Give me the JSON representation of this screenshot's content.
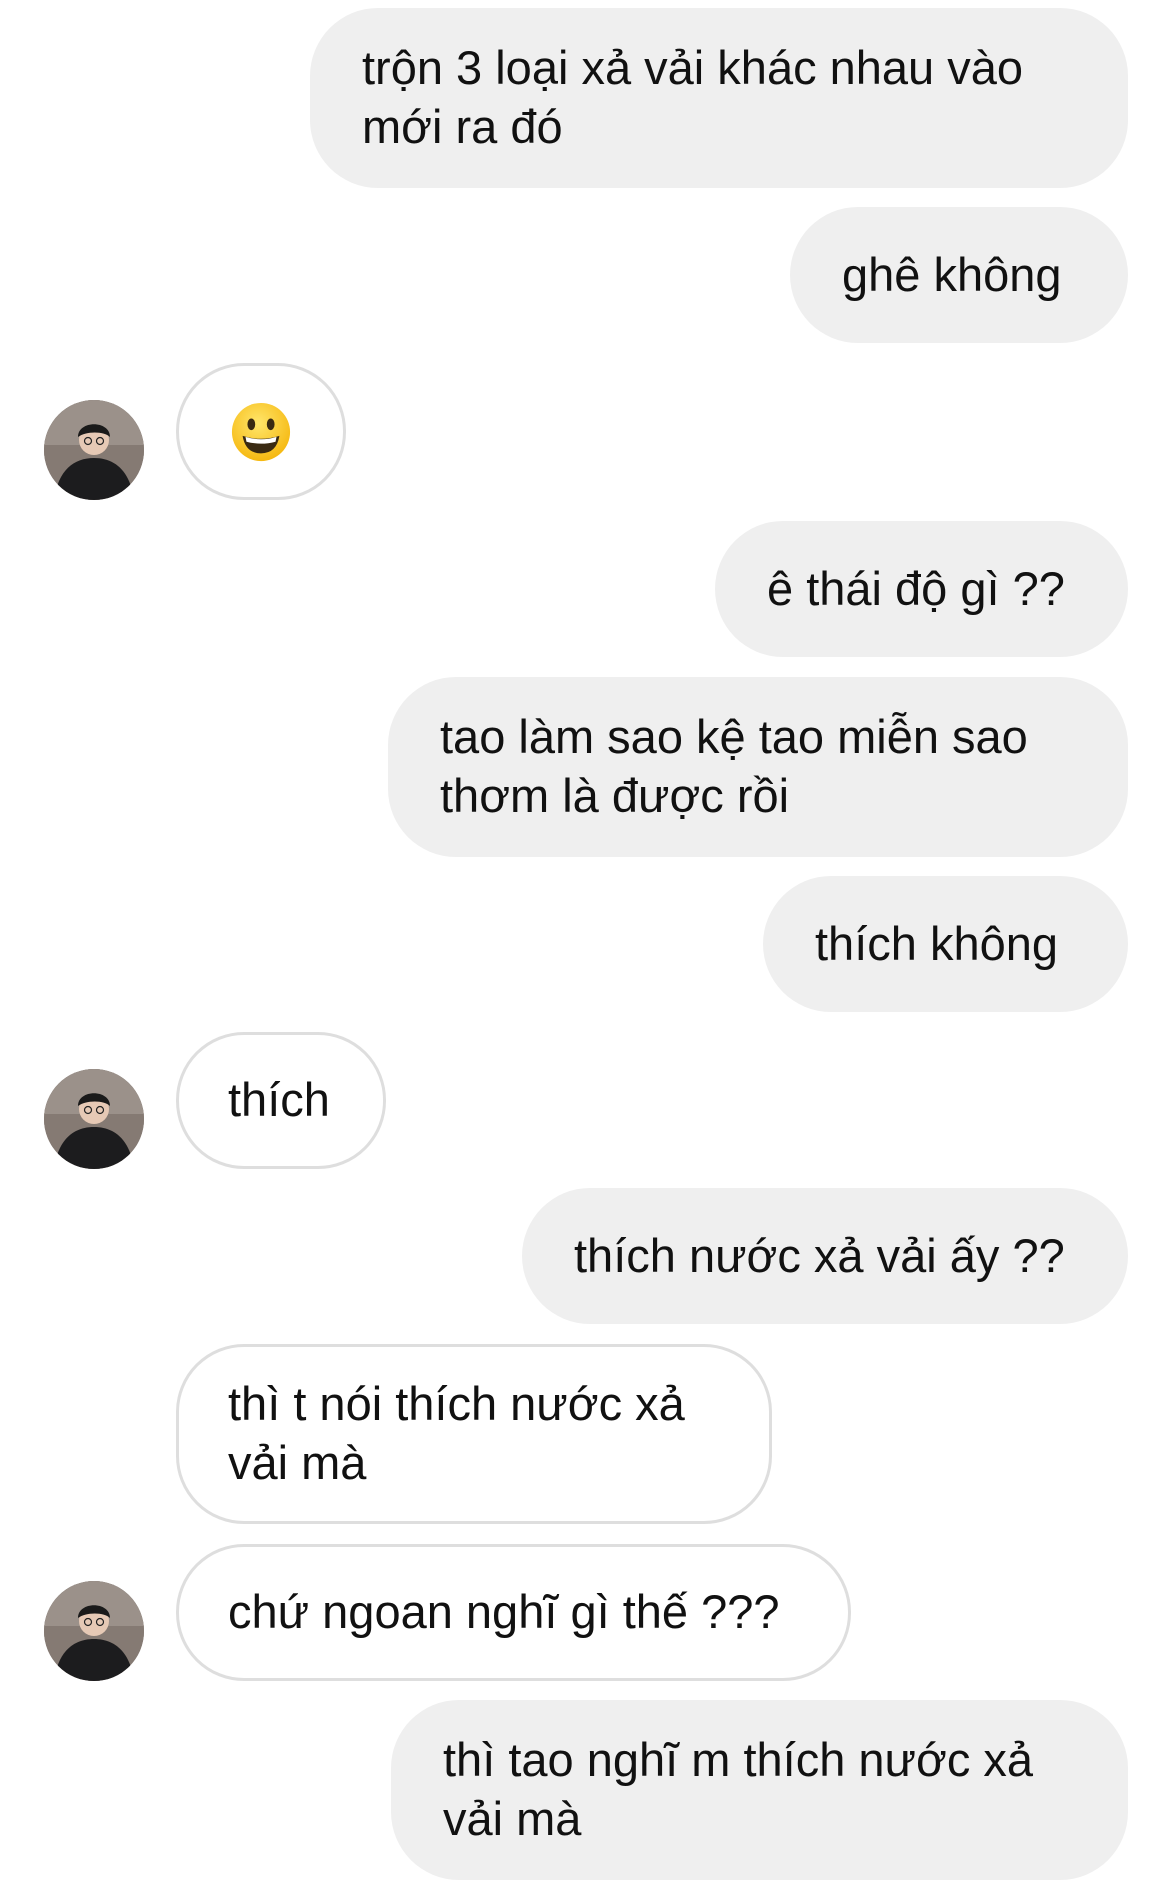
{
  "conversation": {
    "messages": [
      {
        "sender": "me",
        "text": "trộn 3 loại xả vải khác nhau vào mới ra đó"
      },
      {
        "sender": "me",
        "text": "ghê không"
      },
      {
        "sender": "them",
        "emoji": "grinning-face-icon",
        "text": ""
      },
      {
        "sender": "me",
        "text": "ê thái độ gì ??"
      },
      {
        "sender": "me",
        "text": "tao làm sao kệ tao miễn sao thơm là được rồi"
      },
      {
        "sender": "me",
        "text": "thích không"
      },
      {
        "sender": "them",
        "text": "thích"
      },
      {
        "sender": "me",
        "text": "thích nước xả vải ấy ??"
      },
      {
        "sender": "them",
        "text": "thì t nói thích nước xả vải mà"
      },
      {
        "sender": "them",
        "text": "chứ ngoan nghĩ gì thế ???"
      },
      {
        "sender": "me",
        "text": "thì tao nghĩ m thích nước xả vải mà"
      }
    ]
  },
  "colors": {
    "outgoing_bubble": "#efefef",
    "incoming_bubble": "#ffffff",
    "incoming_border": "#dedede",
    "text": "#111111"
  }
}
